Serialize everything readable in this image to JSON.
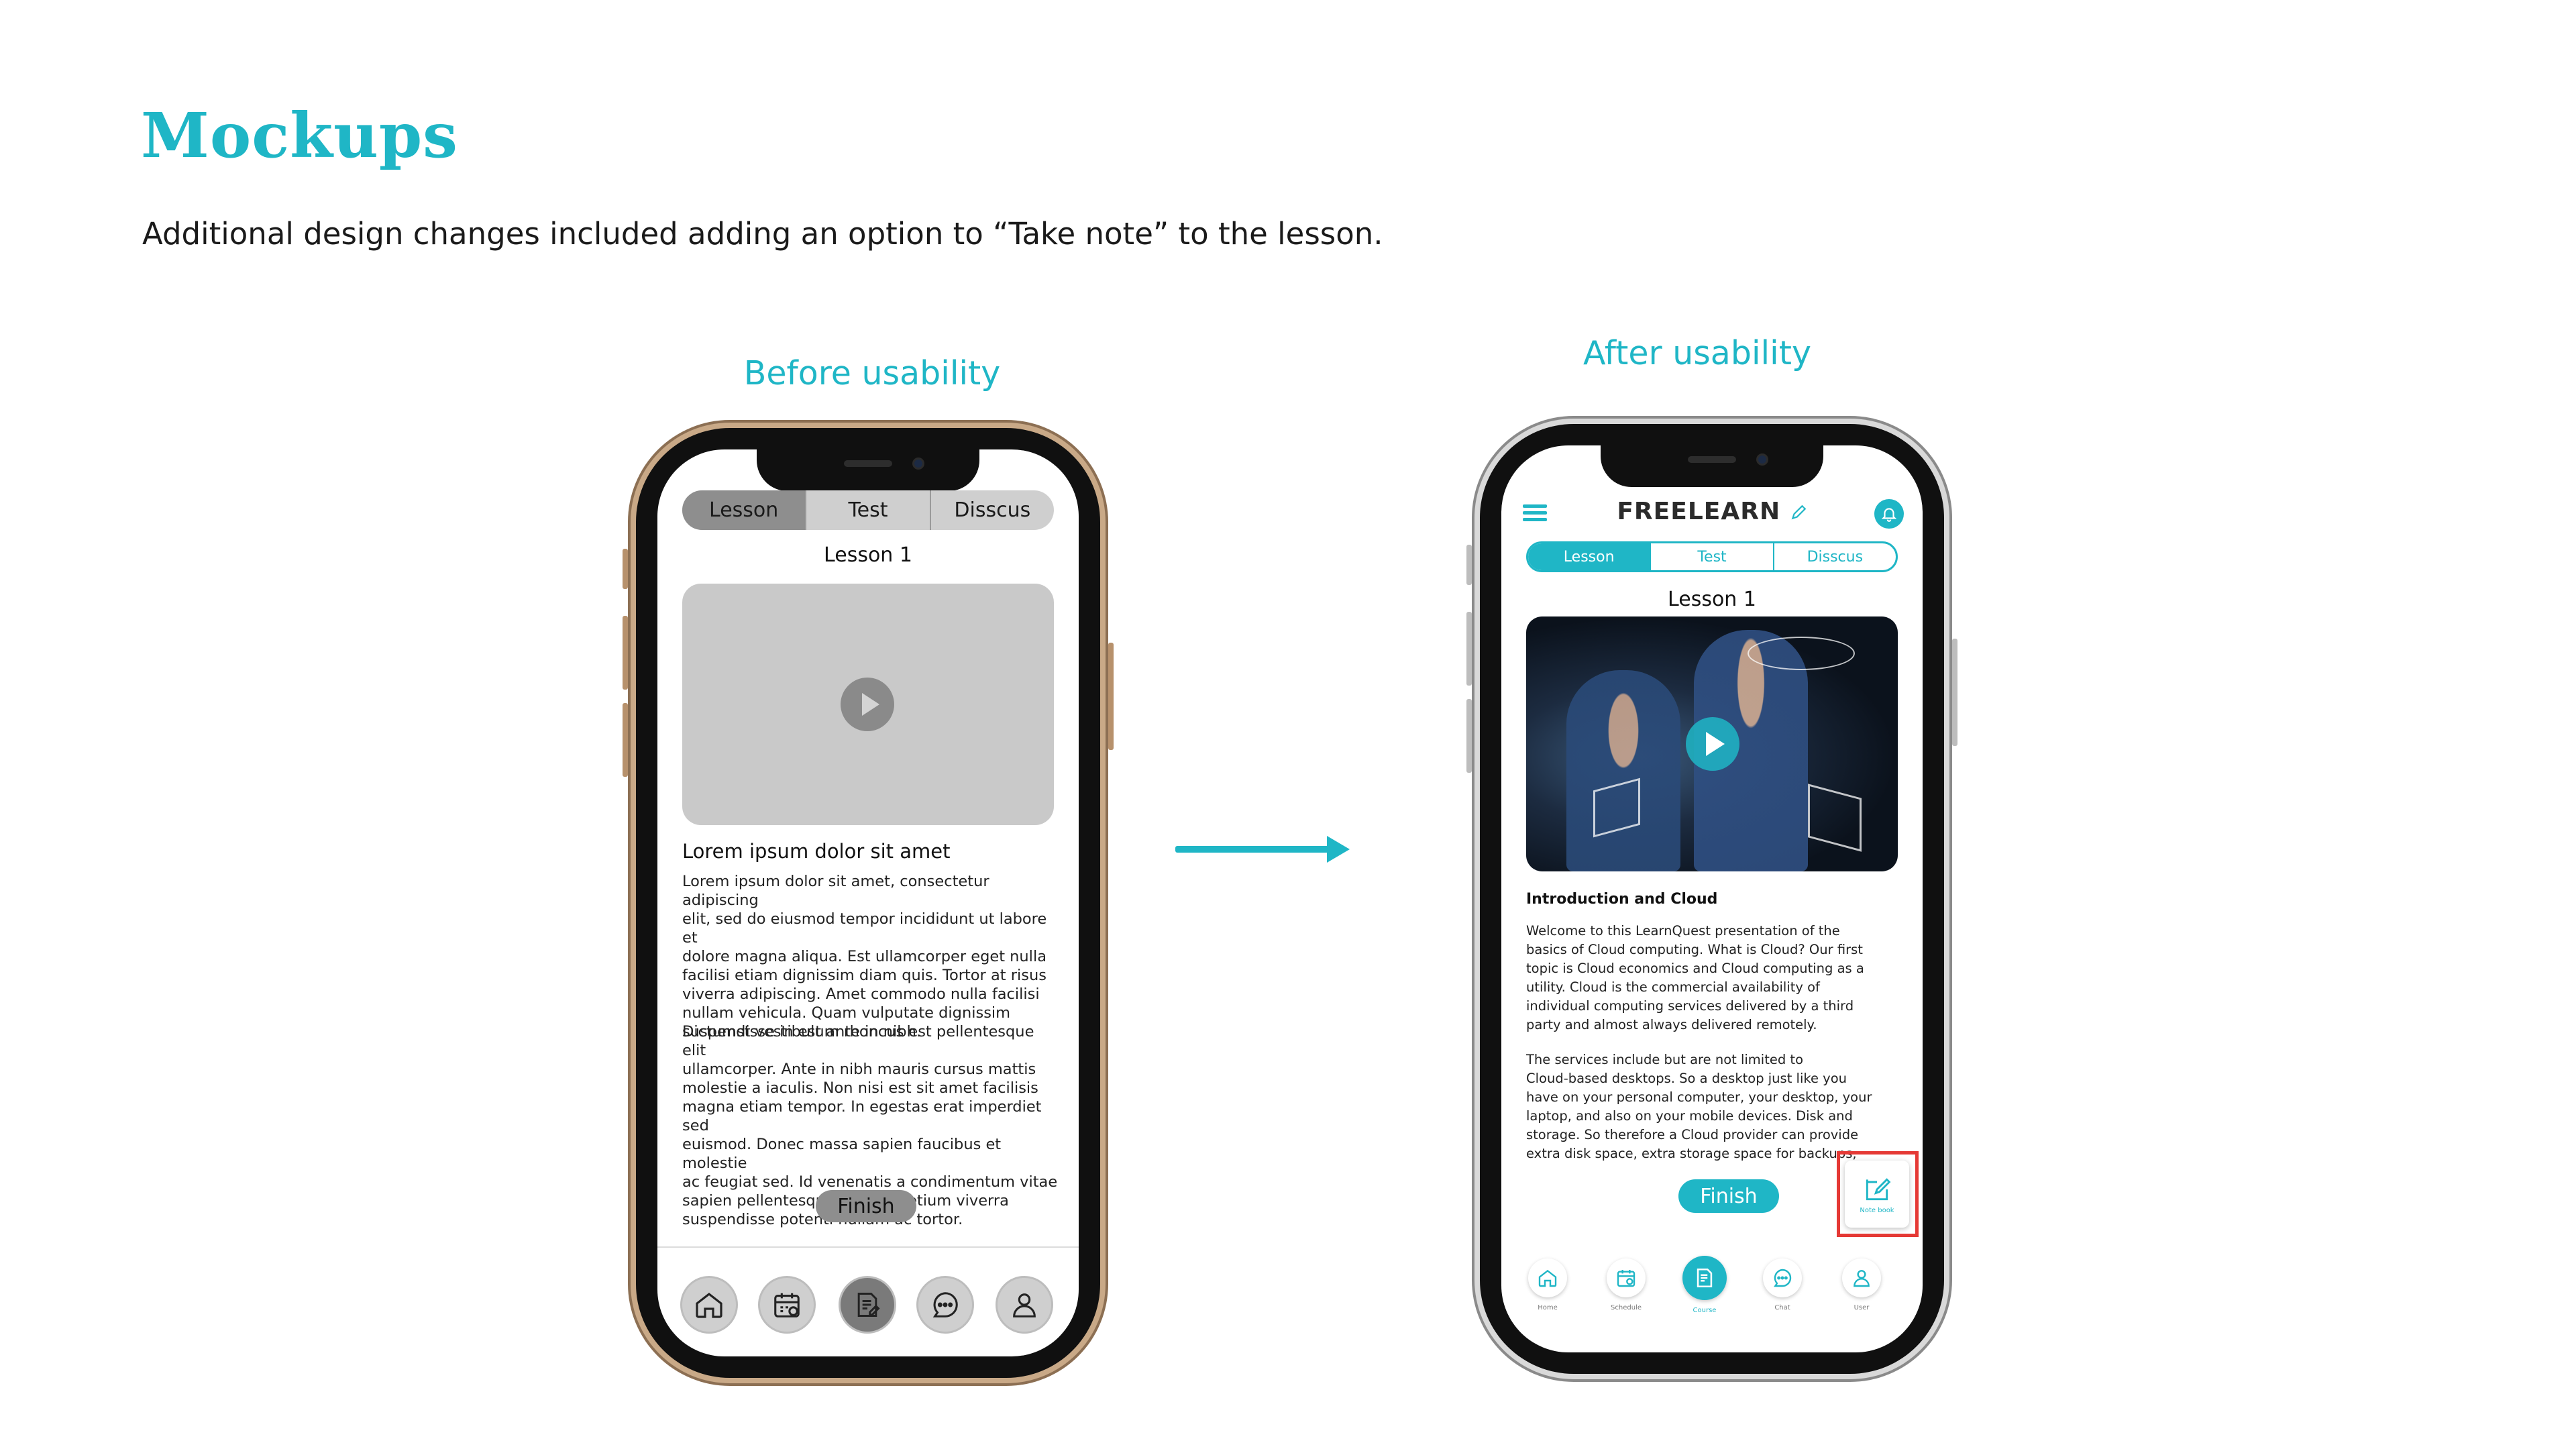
{
  "page": {
    "title": "Mockups",
    "subtitle": "Additional design changes included adding an option to “Take note” to the lesson.",
    "before_heading": "Before usability",
    "after_heading": "After usability"
  },
  "colors": {
    "accent": "#1fb6c6",
    "highlight": "#e53935",
    "wireframe_gray": "#8e8e8e"
  },
  "before": {
    "tabs": [
      {
        "label": "Lesson",
        "active": true
      },
      {
        "label": "Test",
        "active": false
      },
      {
        "label": "Disscus",
        "active": false
      }
    ],
    "lesson_title": "Lesson 1",
    "content_heading": "Lorem ipsum dolor sit amet",
    "paragraphs": [
      [
        "Lorem ipsum dolor sit amet, consectetur adipiscing",
        "elit, sed do eiusmod tempor incididunt ut labore et",
        "dolore magna aliqua. Est ullamcorper eget nulla",
        "facilisi etiam dignissim diam quis. Tortor at risus",
        "viverra adipiscing. Amet commodo nulla facilisi",
        "nullam vehicula. Quam vulputate dignissim",
        "suspendisse in est ante in nibh."
      ],
      [
        "Dictumst vestibulum rhoncus est pellentesque elit",
        "ullamcorper. Ante in nibh mauris cursus mattis",
        "molestie a iaculis. Non nisi est sit amet facilisis",
        "magna etiam tempor. In egestas erat imperdiet sed",
        "euismod. Donec massa sapien faucibus et molestie",
        "ac feugiat sed. Id venenatis a condimentum vitae",
        "sapien pellentesque. Tortor pretium viverra",
        "suspendisse potenti nullam ac tortor."
      ]
    ],
    "finish_label": "Finish",
    "nav_icons": [
      "home-icon",
      "calendar-icon",
      "course-icon",
      "chat-icon",
      "user-icon"
    ]
  },
  "after": {
    "brand": "FREELEARN",
    "tabs": [
      {
        "label": "Lesson",
        "active": true
      },
      {
        "label": "Test",
        "active": false
      },
      {
        "label": "Disscus",
        "active": false
      }
    ],
    "lesson_title": "Lesson 1",
    "content_heading": "Introduction and Cloud",
    "paragraphs": [
      [
        "Welcome to this LearnQuest presentation of the",
        "basics of Cloud computing. What is Cloud? Our first",
        "topic is Cloud economics and Cloud computing as a",
        "utility. Cloud is the commercial availability of",
        "individual computing services delivered by a third",
        "party and almost always delivered remotely."
      ],
      [
        "The services include but are not limited to",
        "Cloud-based desktops. So a desktop just like you",
        "have on your personal computer, your desktop, your",
        "laptop, and also on your mobile devices. Disk and",
        "storage. So therefore a Cloud provider can provide",
        "extra disk space, extra storage space for backups,"
      ]
    ],
    "finish_label": "Finish",
    "notebook_label": "Note book",
    "nav": [
      {
        "label": "Home",
        "icon": "home-icon",
        "active": false
      },
      {
        "label": "Schedule",
        "icon": "calendar-icon",
        "active": false
      },
      {
        "label": "Course",
        "icon": "course-icon",
        "active": true
      },
      {
        "label": "Chat",
        "icon": "chat-icon",
        "active": false
      },
      {
        "label": "User",
        "icon": "user-icon",
        "active": false
      }
    ]
  }
}
